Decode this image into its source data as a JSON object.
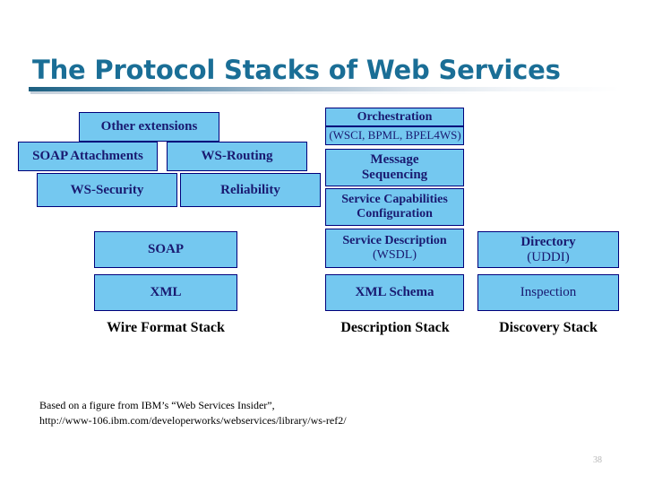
{
  "slide": {
    "title": "The Protocol Stacks of Web Services",
    "page_number": "38",
    "accent_color": "#1a6e96",
    "box_fill_color": "#74c8f0",
    "box_border_color": "#00007a",
    "box_text_color": "#191970"
  },
  "wire_format_stack": {
    "caption": "Wire Format Stack",
    "boxes": [
      {
        "label": "Other extensions"
      },
      {
        "label": "SOAP Attachments"
      },
      {
        "label": "WS-Routing"
      },
      {
        "label": "WS-Security"
      },
      {
        "label": "Reliability"
      },
      {
        "label": "SOAP"
      },
      {
        "label": "XML"
      }
    ]
  },
  "description_stack": {
    "caption": "Description Stack",
    "boxes": [
      {
        "label": "Orchestration",
        "sublabel": "(WSCI, BPML, BPEL4WS)"
      },
      {
        "line1": "Message",
        "line2": "Sequencing"
      },
      {
        "line1": "Service Capabilities",
        "line2": "Configuration"
      },
      {
        "line1": "Service Description",
        "line2": "(WSDL)"
      },
      {
        "label": "XML Schema"
      }
    ]
  },
  "discovery_stack": {
    "caption": "Discovery Stack",
    "boxes": [
      {
        "line1": "Directory",
        "line2": "(UDDI)"
      },
      {
        "label": "Inspection"
      }
    ]
  },
  "footer": {
    "line1": "Based on a figure from IBM’s “Web Services Insider”,",
    "line2": "http://www-106.ibm.com/developerworks/webservices/library/ws-ref2/"
  }
}
